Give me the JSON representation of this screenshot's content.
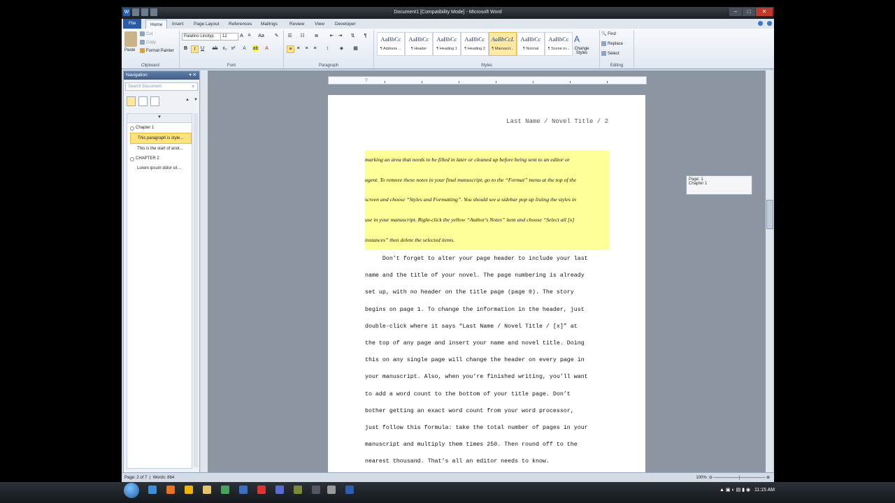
{
  "titlebar": {
    "title": "Document1 [Compatibility Mode] - Microsoft Word",
    "word_badge": "W"
  },
  "tabs": [
    "File",
    "Home",
    "Insert",
    "Page Layout",
    "References",
    "Mailings",
    "Review",
    "View",
    "Developer"
  ],
  "clipboard": {
    "paste": "Paste",
    "cut": "Cut",
    "copy": "Copy",
    "format_painter": "Format Painter",
    "label": "Clipboard"
  },
  "font": {
    "name": "Palatino Linotyp",
    "size": "12",
    "label": "Font"
  },
  "paragraph": {
    "label": "Paragraph"
  },
  "styles": {
    "label": "Styles",
    "items": [
      {
        "sample": "AaBbCc",
        "name": "¶ Address ..."
      },
      {
        "sample": "AaBbCc",
        "name": "¶ Header"
      },
      {
        "sample": "AaBbCc",
        "name": "¶ Heading 1"
      },
      {
        "sample": "AaBbCc",
        "name": "¶ Heading 2"
      },
      {
        "sample": "AaBbCcL",
        "name": "¶ Manuscri..."
      },
      {
        "sample": "AaBbCc",
        "name": "¶ Normal"
      },
      {
        "sample": "AaBbCc",
        "name": "¶ Scene m..."
      }
    ],
    "change_styles": "Change Styles"
  },
  "editing": {
    "find": "Find",
    "replace": "Replace",
    "select": "Select",
    "label": "Editing"
  },
  "navigation": {
    "title": "Navigation",
    "search_placeholder": "Search Document",
    "items": [
      {
        "label": "Chapter 1",
        "level": 1,
        "highlight": false
      },
      {
        "label": "This paragraph is style...",
        "level": 2,
        "highlight": true
      },
      {
        "label": "This is the start of anot...",
        "level": 2,
        "highlight": false
      },
      {
        "label": "CHAPTER 2",
        "level": 1,
        "highlight": false
      },
      {
        "label": "Lorem ipsum dolor sit ...",
        "level": 2,
        "highlight": false
      }
    ]
  },
  "document": {
    "header": "Last Name / Novel Title / 2",
    "note_lines": [
      "marking an area that needs to be filled in later or cleaned up before being sent to an editor or",
      "agent. To remove these notes in your final manuscript, go to the “Format” menu at the top of the",
      "screen and choose “Styles and Formatting”. You should see a sidebar pop up listing the styles in",
      "use in your manuscript. Right-click the yellow “Author's Notes” item and choose “Select all [x]",
      "instances” then delete the selected items."
    ],
    "body_lines": [
      "     Don’t forget to alter your page header to include your last",
      "name and the title of your novel. The page numbering is already",
      "set up, with no header on the title page (page 0). The story",
      "begins on page 1. To change the information in the header, just",
      "double-click where it says “Last Name / Novel Title / [x]” at",
      "the top of any page and insert your name and novel title. Doing",
      "this on any single page will change the header on every page in",
      "your manuscript. Also, when you’re finished writing, you’ll want",
      "to add a word count to the bottom of your title page. Don’t",
      "bother getting an exact word count from your word processor,",
      "just follow this formula: take the total number of pages in your",
      "manuscript and multiply them times 250. Then round off to the",
      "nearest thousand. That’s all an editor needs to know."
    ]
  },
  "scroll_tip": {
    "page": "Page: 1",
    "chapter": "Chapter 1"
  },
  "status": {
    "page": "Page: 2 of 7",
    "words": "Words: 884",
    "zoom": "100%"
  },
  "taskbar": {
    "time": "11:15 AM"
  },
  "colors": {
    "highlight": "#ffff9a",
    "file_tab": "#2a5aa8",
    "selected_style": "#ffe9a3"
  }
}
